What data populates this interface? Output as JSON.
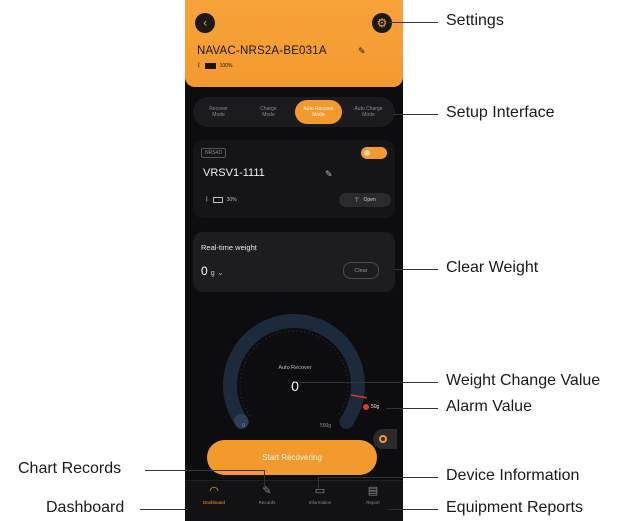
{
  "header": {
    "device_name": "NAVAC-NRS2A-BE031A",
    "battery_text": "100%"
  },
  "modes": [
    {
      "line1": "Recover",
      "line2": "Mode",
      "active": false
    },
    {
      "line1": "Charge",
      "line2": "Mode",
      "active": false
    },
    {
      "line1": "Auto Recover",
      "line2": "Mode",
      "active": true
    },
    {
      "line1": "Auto Charge",
      "line2": "Mode",
      "active": false
    }
  ],
  "device_card": {
    "tag": "NRS4D",
    "device_id": "VRSV1-1111",
    "battery_text": "30%",
    "open_text": "Open",
    "toggle_on": true
  },
  "weight_card": {
    "title": "Real-time weight",
    "value": "0",
    "unit": "g",
    "clear_label": "Clear"
  },
  "gauge": {
    "mode_label": "Auto Recover",
    "value": "0",
    "min_label": "0",
    "max_label": "500g",
    "alarm_label": "50g",
    "value_fraction": 0.0,
    "alarm_fraction": 0.1,
    "colors": {
      "track": "#1d2a3c",
      "progress": "#2b3f5a",
      "alarm": "#e0392b"
    }
  },
  "start_button": {
    "label": "Start Recovering"
  },
  "tabs": [
    {
      "label": "Dashboard",
      "icon": "gauge-icon",
      "active": true
    },
    {
      "label": "Records",
      "icon": "edit-icon",
      "active": false
    },
    {
      "label": "Information",
      "icon": "device-icon",
      "active": false
    },
    {
      "label": "Report",
      "icon": "report-icon",
      "active": false
    }
  ],
  "callouts": {
    "settings": "Settings",
    "setup_interface": "Setup Interface",
    "clear_weight": "Clear Weight",
    "weight_change_value": "Weight Change Value",
    "alarm_value": "Alarm Value",
    "chart_records": "Chart Records",
    "device_information": "Device Information",
    "dashboard": "Dashboard",
    "equipment_reports": "Equipment Reports"
  },
  "colors": {
    "accent": "#f39a2f",
    "background": "#0d0d0f"
  }
}
